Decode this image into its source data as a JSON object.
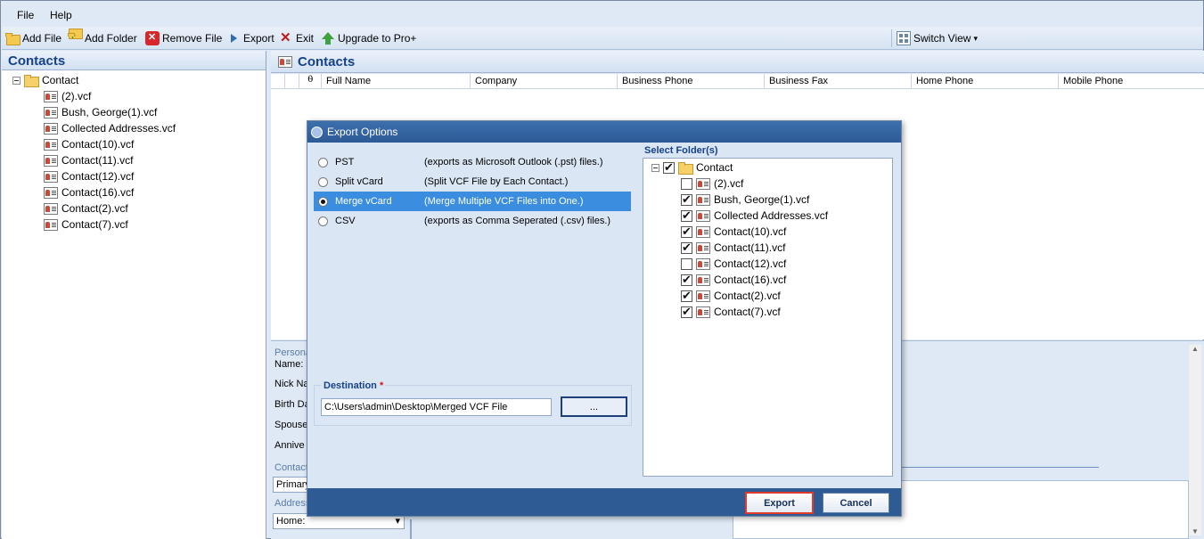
{
  "menu": [
    "File",
    "Help"
  ],
  "toolbar": {
    "add_file": "Add File",
    "add_folder": "Add Folder",
    "remove_file": "Remove File",
    "export": "Export",
    "exit": "Exit",
    "upgrade": "Upgrade to Pro+",
    "switch_view": "Switch View"
  },
  "left_panel": {
    "title": "Contacts",
    "root": "Contact",
    "files": [
      "(2).vcf",
      "Bush, George(1).vcf",
      "Collected Addresses.vcf",
      "Contact(10).vcf",
      "Contact(11).vcf",
      "Contact(12).vcf",
      "Contact(16).vcf",
      "Contact(2).vcf",
      "Contact(7).vcf"
    ]
  },
  "main": {
    "title": "Contacts",
    "columns": [
      "Full Name",
      "Company",
      "Business Phone",
      "Business Fax",
      "Home Phone",
      "Mobile Phone"
    ]
  },
  "details": {
    "personal_label": "Persona",
    "name_label": "Name:",
    "nick_label": "Nick Nar",
    "birth_label": "Birth Da",
    "spouse_label": "Spouse",
    "anniv_label": "Annive",
    "contact_label": "Contact",
    "primary_value": "Primary",
    "address_label": "Address",
    "home_value": "Home:"
  },
  "dialog": {
    "title": "Export Options",
    "options": [
      {
        "name": "PST",
        "desc": "(exports as Microsoft Outlook (.pst) files.)",
        "selected": false
      },
      {
        "name": "Split vCard",
        "desc": "(Split VCF File by Each Contact.)",
        "selected": false
      },
      {
        "name": "Merge vCard",
        "desc": "(Merge Multiple VCF Files into One.)",
        "selected": true
      },
      {
        "name": "CSV",
        "desc": "(exports as Comma Seperated (.csv) files.)",
        "selected": false
      }
    ],
    "destination_label": "Destination",
    "required_mark": "*",
    "destination_value": "C:\\Users\\admin\\Desktop\\Merged VCF File",
    "browse_label": "...",
    "select_folder_label": "Select Folder(s)",
    "tree_root": "Contact",
    "tree_items": [
      {
        "label": "(2).vcf",
        "checked": false
      },
      {
        "label": "Bush, George(1).vcf",
        "checked": true
      },
      {
        "label": "Collected Addresses.vcf",
        "checked": true
      },
      {
        "label": "Contact(10).vcf",
        "checked": true
      },
      {
        "label": "Contact(11).vcf",
        "checked": true
      },
      {
        "label": "Contact(12).vcf",
        "checked": false
      },
      {
        "label": "Contact(16).vcf",
        "checked": true
      },
      {
        "label": "Contact(2).vcf",
        "checked": true
      },
      {
        "label": "Contact(7).vcf",
        "checked": true
      }
    ],
    "export_btn": "Export",
    "cancel_btn": "Cancel"
  }
}
